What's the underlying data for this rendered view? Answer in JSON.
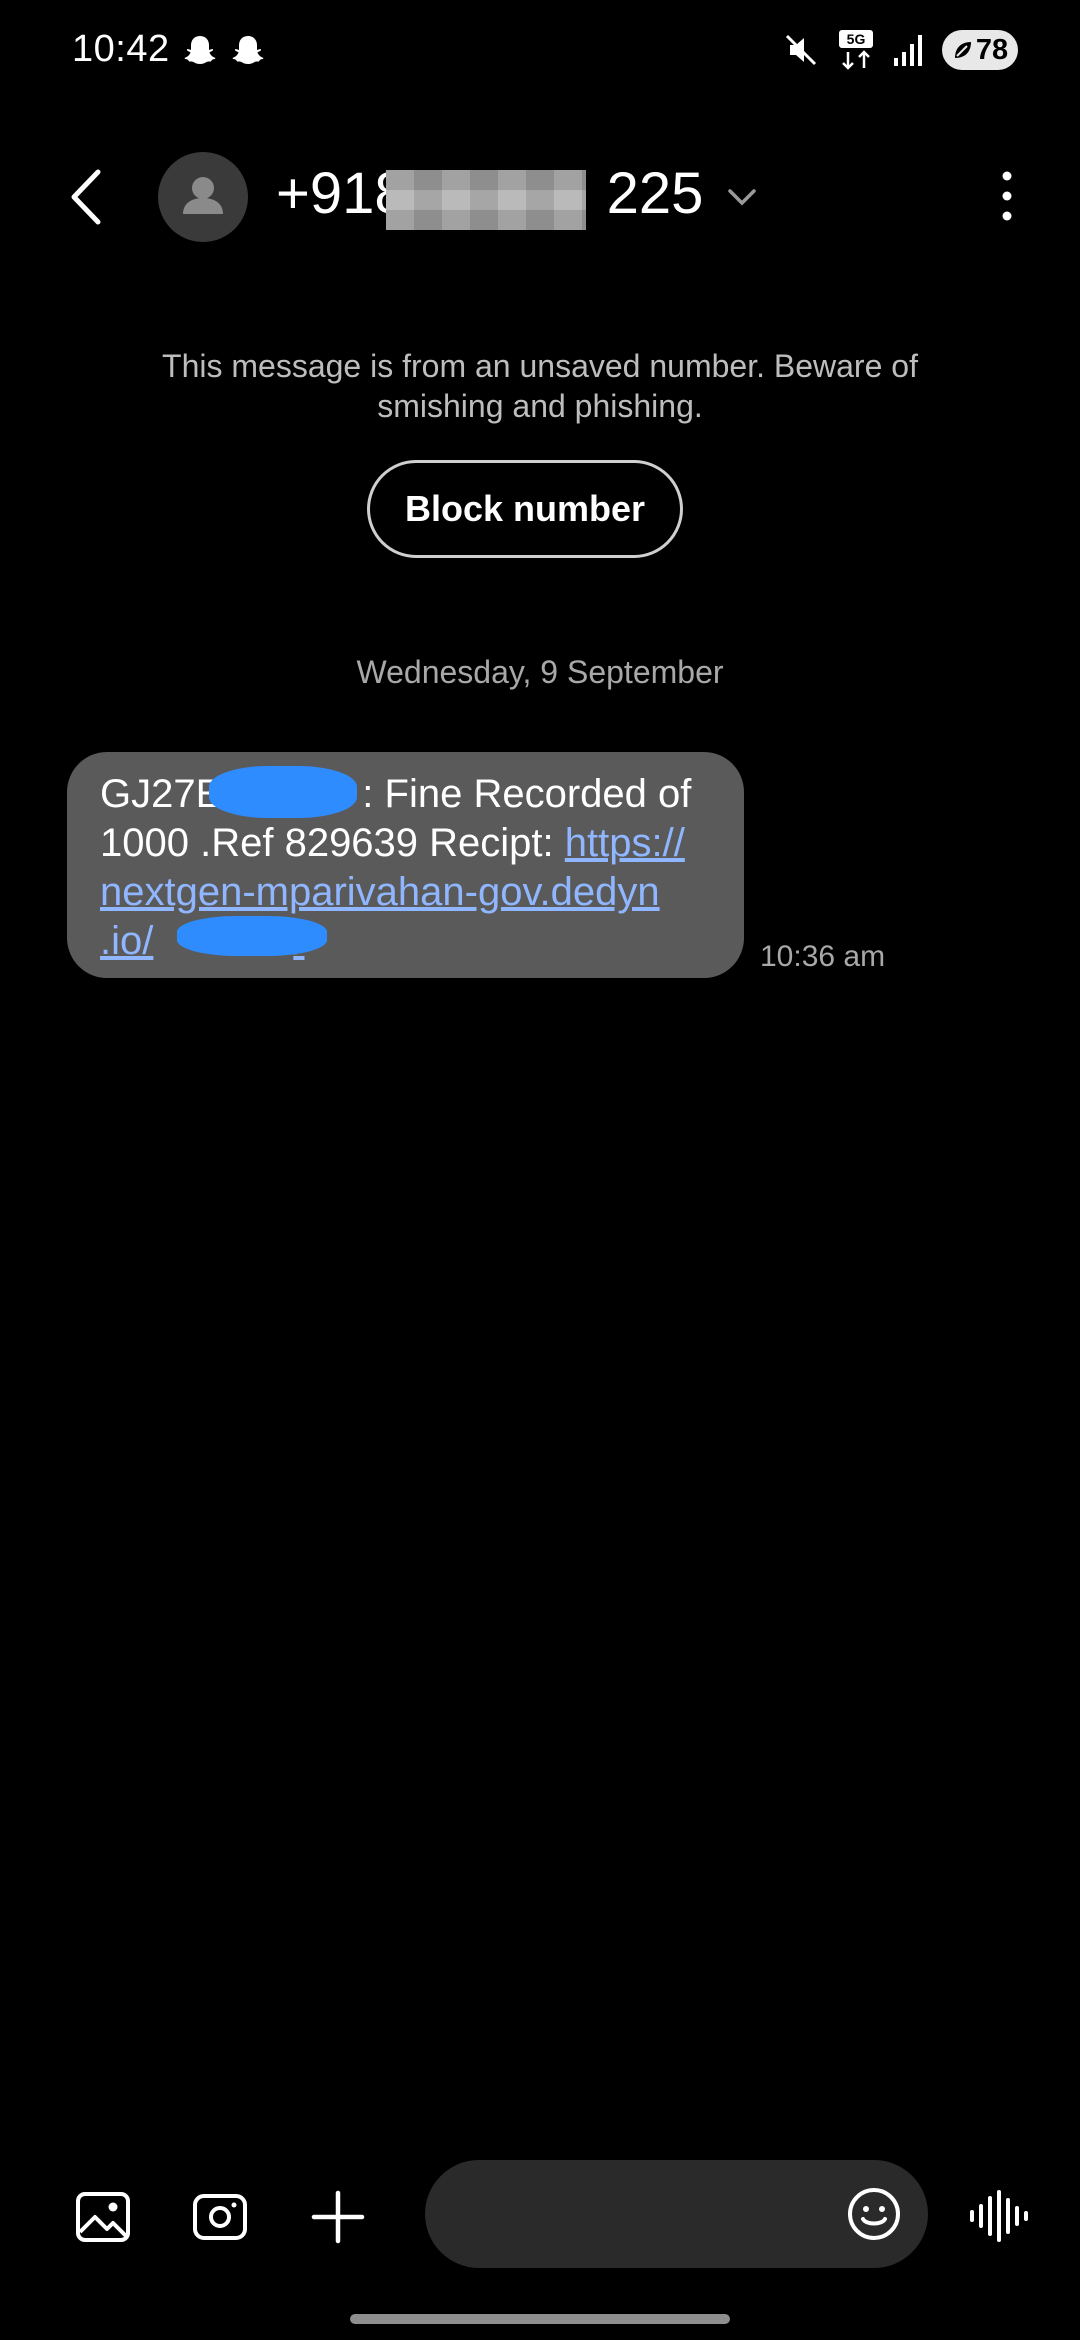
{
  "status_bar": {
    "time": "10:42",
    "network": "5G",
    "battery": "78"
  },
  "header": {
    "contact_prefix": "+918",
    "contact_suffix": "225"
  },
  "warning": {
    "text": "This message is from an unsaved number. Beware of smishing and phishing.",
    "block_button": "Block number"
  },
  "date_separator": "Wednesday, 9 September",
  "message": {
    "line1_start": "GJ27E",
    "line1_end": ": Fine Recorded of",
    "line2": "1000 .Ref 829639 Recipt: ",
    "link_line2": "https://",
    "link_line3": "nextgen-mparivahan-gov.dedyn",
    "link_line4": ".io/",
    "link_line4_end": "/",
    "time": "10:36 am"
  },
  "composer": {
    "placeholder": ""
  },
  "colors": {
    "background": "#000000",
    "bubble": "#5a5a5a",
    "link": "#8fb6ff",
    "redaction_scribble": "#2f8cff"
  }
}
